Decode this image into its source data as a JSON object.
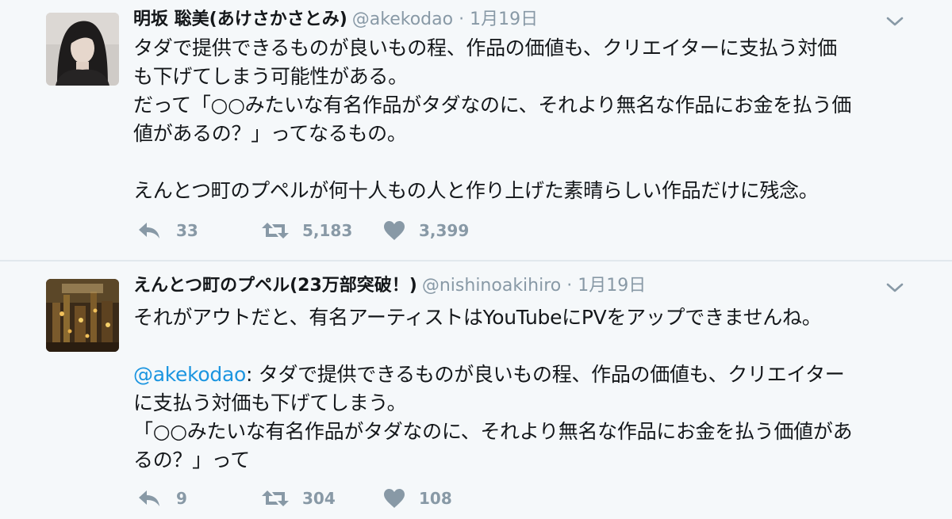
{
  "tweets": [
    {
      "author_name": "明坂 聡美(あけさかさとみ)",
      "handle": "@akekodao",
      "separator": "·",
      "timestamp": "1月19日",
      "avatar_icon": "portrait-avatar",
      "lines": [
        "タダで提供できるものが良いもの程、作品の価値も、クリエイターに支払う対価",
        "も下げてしまう可能性がある。",
        "だって「○○みたいな有名作品がタダなのに、それより無名な作品にお金を払う価",
        "値があるの？」ってなるもの。",
        "",
        "えんとつ町のプペルが何十人もの人と作り上げた素晴らしい作品だけに残念。"
      ],
      "replies": "33",
      "retweets": "5,183",
      "likes": "3,399"
    },
    {
      "author_name": "えんとつ町のプペル(23万部突破！)",
      "handle": "@nishinoakihiro",
      "separator": "·",
      "timestamp": "1月19日",
      "avatar_icon": "book-cover-avatar",
      "line1": "それがアウトだと、有名アーティストはYouTubeにPVをアップできませんね。",
      "quote_mention": "@akekodao",
      "quote_line1_rest": ": タダで提供できるものが良いもの程、作品の価値も、クリエイター",
      "quote_line2": "に支払う対価も下げてしまう。",
      "quote_line3": "「○○みたいな有名作品がタダなのに、それより無名な作品にお金を払う価値があ",
      "quote_line4": "るの？」って",
      "replies": "9",
      "retweets": "304",
      "likes": "108"
    }
  ],
  "colors": {
    "background": "#f5f8fa",
    "text": "#14171a",
    "muted": "#8899a6",
    "mention": "#1b95e0",
    "divider": "#e1e8ed"
  },
  "icons": [
    "reply-icon",
    "retweet-icon",
    "like-icon",
    "chevron-down-icon"
  ]
}
